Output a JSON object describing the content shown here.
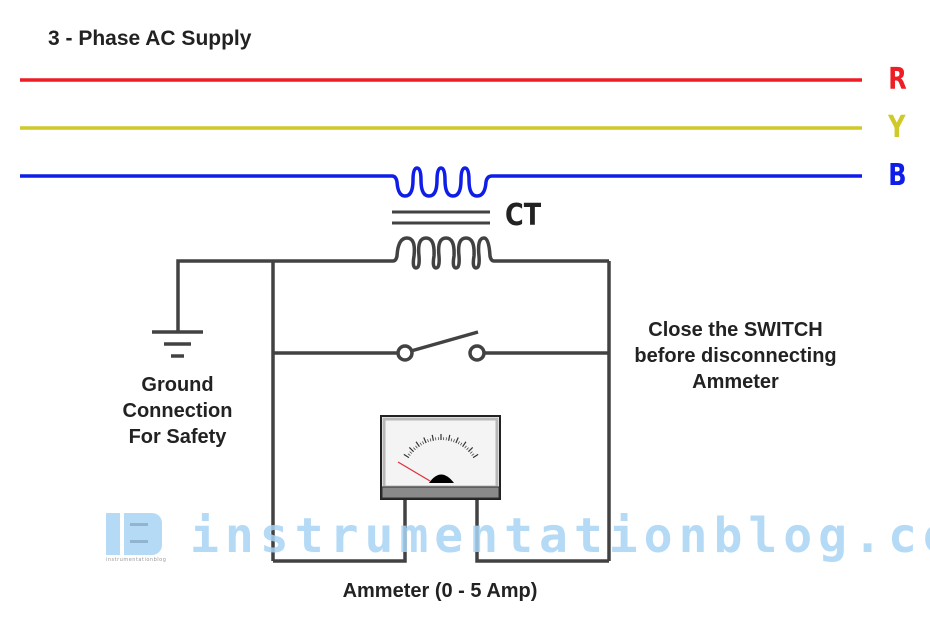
{
  "title": "3 - Phase AC Supply",
  "phases": [
    {
      "label": "R",
      "color": "#ee1c24"
    },
    {
      "label": "Y",
      "color": "#cfc92a"
    },
    {
      "label": "B",
      "color": "#0e1de8"
    }
  ],
  "ct_label": "CT",
  "ground_label": [
    "Ground",
    "Connection",
    "For Safety"
  ],
  "switch_note": [
    "Close the SWITCH",
    "before disconnecting",
    "Ammeter"
  ],
  "ammeter_label": "Ammeter (0 - 5 Amp)",
  "watermark": {
    "logo": "IB",
    "text": "instrumentationblog.com",
    "subtext": "instrumentationblog"
  },
  "colors": {
    "wire": "#424242",
    "watermark": "#a9d4f5",
    "needle": "#e0303a"
  }
}
